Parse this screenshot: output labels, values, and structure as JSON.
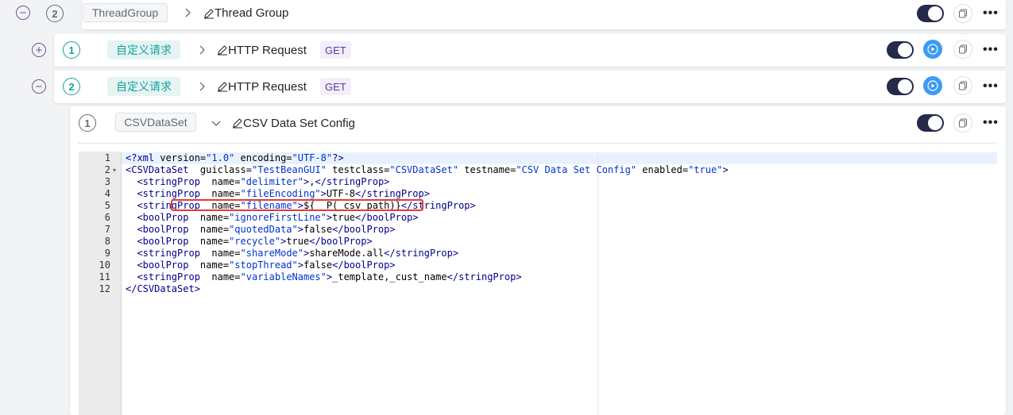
{
  "rows": [
    {
      "num": "2",
      "tag": "ThreadGroup",
      "title": "Thread Group",
      "method": ""
    },
    {
      "num": "1",
      "tag": "自定义请求",
      "title": "HTTP Request",
      "method": "GET"
    },
    {
      "num": "2",
      "tag": "自定义请求",
      "title": "HTTP Request",
      "method": "GET"
    },
    {
      "num": "1",
      "tag": "CSVDataSet",
      "title": "CSV Data Set Config",
      "method": ""
    }
  ],
  "toggle_symbols": {
    "minus": "−",
    "plus": "+"
  },
  "more_label": "•••",
  "editor": {
    "line_numbers": [
      "1",
      "2",
      "3",
      "4",
      "5",
      "6",
      "7",
      "8",
      "9",
      "10",
      "11",
      "12"
    ],
    "lines": [
      [
        {
          "c": "t",
          "v": "<?xml"
        },
        {
          "c": "",
          "v": " version="
        },
        {
          "c": "s",
          "v": "\"1.0\""
        },
        {
          "c": "",
          "v": " encoding="
        },
        {
          "c": "s",
          "v": "\"UTF-8\""
        },
        {
          "c": "t",
          "v": "?>"
        }
      ],
      [
        {
          "c": "t",
          "v": "<CSVDataSet"
        },
        {
          "c": "",
          "v": "  guiclass="
        },
        {
          "c": "s",
          "v": "\"TestBeanGUI\""
        },
        {
          "c": "",
          "v": " testclass="
        },
        {
          "c": "s",
          "v": "\"CSVDataSet\""
        },
        {
          "c": "",
          "v": " testname="
        },
        {
          "c": "s",
          "v": "\"CSV Data Set Config\""
        },
        {
          "c": "",
          "v": " enabled="
        },
        {
          "c": "s",
          "v": "\"true\""
        },
        {
          "c": "t",
          "v": ">"
        }
      ],
      [
        {
          "c": "",
          "v": "  "
        },
        {
          "c": "t",
          "v": "<stringProp"
        },
        {
          "c": "",
          "v": "  name="
        },
        {
          "c": "s",
          "v": "\"delimiter\""
        },
        {
          "c": "t",
          "v": ">"
        },
        {
          "c": "",
          "v": ","
        },
        {
          "c": "t",
          "v": "</stringProp>"
        }
      ],
      [
        {
          "c": "",
          "v": "  "
        },
        {
          "c": "t",
          "v": "<stringProp"
        },
        {
          "c": "",
          "v": "  name="
        },
        {
          "c": "s",
          "v": "\"fileEncoding\""
        },
        {
          "c": "t",
          "v": ">"
        },
        {
          "c": "",
          "v": "UTF-8"
        },
        {
          "c": "t",
          "v": "</stringProp>"
        }
      ],
      [
        {
          "c": "",
          "v": "  "
        },
        {
          "c": "t",
          "v": "<stringProp"
        },
        {
          "c": "",
          "v": "  name="
        },
        {
          "c": "s",
          "v": "\"filename\""
        },
        {
          "c": "t",
          "v": ">"
        },
        {
          "c": "",
          "v": "${__P(_csv_path)}"
        },
        {
          "c": "t",
          "v": "</stringProp>"
        }
      ],
      [
        {
          "c": "",
          "v": "  "
        },
        {
          "c": "t",
          "v": "<boolProp"
        },
        {
          "c": "",
          "v": "  name="
        },
        {
          "c": "s",
          "v": "\"ignoreFirstLine\""
        },
        {
          "c": "t",
          "v": ">"
        },
        {
          "c": "",
          "v": "true"
        },
        {
          "c": "t",
          "v": "</boolProp>"
        }
      ],
      [
        {
          "c": "",
          "v": "  "
        },
        {
          "c": "t",
          "v": "<boolProp"
        },
        {
          "c": "",
          "v": "  name="
        },
        {
          "c": "s",
          "v": "\"quotedData\""
        },
        {
          "c": "t",
          "v": ">"
        },
        {
          "c": "",
          "v": "false"
        },
        {
          "c": "t",
          "v": "</boolProp>"
        }
      ],
      [
        {
          "c": "",
          "v": "  "
        },
        {
          "c": "t",
          "v": "<boolProp"
        },
        {
          "c": "",
          "v": "  name="
        },
        {
          "c": "s",
          "v": "\"recycle\""
        },
        {
          "c": "t",
          "v": ">"
        },
        {
          "c": "",
          "v": "true"
        },
        {
          "c": "t",
          "v": "</boolProp>"
        }
      ],
      [
        {
          "c": "",
          "v": "  "
        },
        {
          "c": "t",
          "v": "<stringProp"
        },
        {
          "c": "",
          "v": "  name="
        },
        {
          "c": "s",
          "v": "\"shareMode\""
        },
        {
          "c": "t",
          "v": ">"
        },
        {
          "c": "",
          "v": "shareMode.all"
        },
        {
          "c": "t",
          "v": "</stringProp>"
        }
      ],
      [
        {
          "c": "",
          "v": "  "
        },
        {
          "c": "t",
          "v": "<boolProp"
        },
        {
          "c": "",
          "v": "  name="
        },
        {
          "c": "s",
          "v": "\"stopThread\""
        },
        {
          "c": "t",
          "v": ">"
        },
        {
          "c": "",
          "v": "false"
        },
        {
          "c": "t",
          "v": "</boolProp>"
        }
      ],
      [
        {
          "c": "",
          "v": "  "
        },
        {
          "c": "t",
          "v": "<stringProp"
        },
        {
          "c": "",
          "v": "  name="
        },
        {
          "c": "s",
          "v": "\"variableNames\""
        },
        {
          "c": "t",
          "v": ">"
        },
        {
          "c": "",
          "v": "_template,_cust_name"
        },
        {
          "c": "t",
          "v": "</stringProp>"
        }
      ],
      [
        {
          "c": "t",
          "v": "</CSVDataSet>"
        }
      ]
    ]
  },
  "colors": {
    "accent_dark": "#252a4a",
    "run_blue": "#3c9bf5",
    "teal": "#12a39c",
    "highlight_red": "#e53935"
  }
}
